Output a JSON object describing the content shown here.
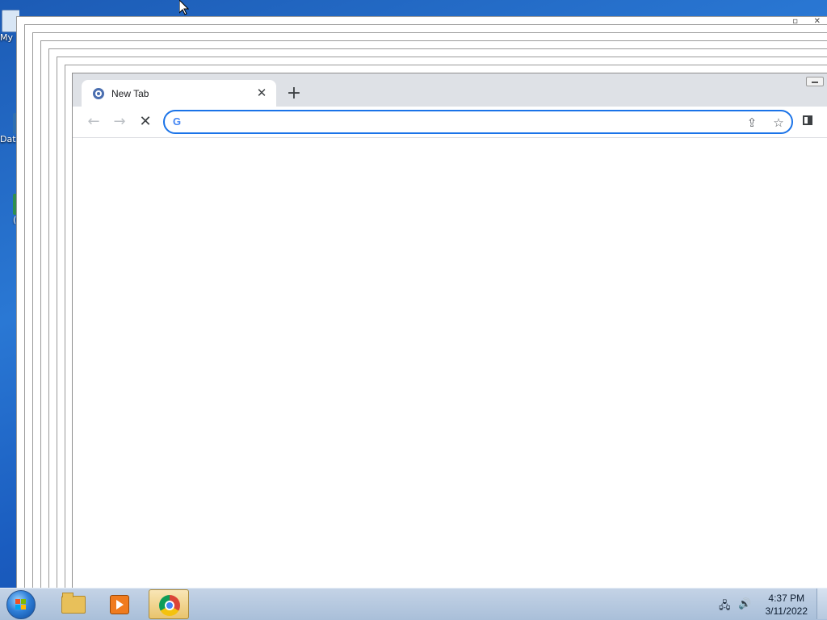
{
  "desktop": {
    "icons": [
      {
        "label": "My"
      },
      {
        "label": "Dat"
      },
      {
        "label": "("
      }
    ]
  },
  "browser": {
    "tab": {
      "title": "New Tab",
      "close_glyph": "✕"
    },
    "new_tab_glyph": "+",
    "nav": {
      "back_glyph": "←",
      "forward_glyph": "→",
      "stop_glyph": "✕"
    },
    "omnibox": {
      "value": "",
      "placeholder": "",
      "provider_letter": "G"
    },
    "share_glyph": "⇪",
    "bookmark_glyph": "☆"
  },
  "taskbar": {
    "clock": {
      "time": "4:37 PM",
      "date": "3/11/2022"
    },
    "tray": {
      "network_glyph": "🖧",
      "volume_glyph": "🔊"
    }
  }
}
